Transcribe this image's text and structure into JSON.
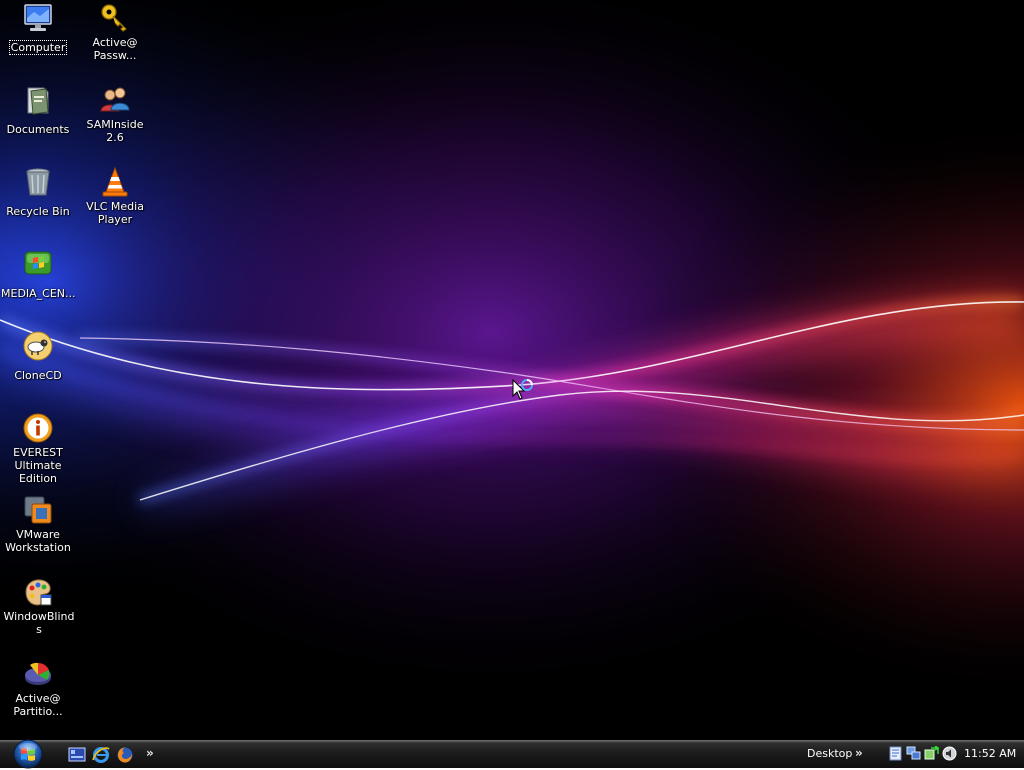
{
  "desktop": {
    "icons": [
      {
        "label": "Computer",
        "icon": "computer-icon"
      },
      {
        "label": "Documents",
        "icon": "documents-folder-icon"
      },
      {
        "label": "Recycle Bin",
        "icon": "recycle-bin-icon"
      },
      {
        "label": "MEDIA_CEN...",
        "icon": "media-center-icon"
      },
      {
        "label": "CloneCD",
        "icon": "clonecd-sheep-icon"
      },
      {
        "label": "EVEREST Ultimate Edition",
        "icon": "everest-info-icon"
      },
      {
        "label": "VMware Workstation",
        "icon": "vmware-icon"
      },
      {
        "label": "WindowBlinds",
        "icon": "windowblinds-palette-icon"
      },
      {
        "label": "Active@ Partitio...",
        "icon": "partition-pie-icon"
      },
      {
        "label": "Active@ Passw...",
        "icon": "key-icon"
      },
      {
        "label": "SAMInside 2.6",
        "icon": "users-icon"
      },
      {
        "label": "VLC Media Player",
        "icon": "vlc-cone-icon"
      }
    ],
    "selected_icon": "Computer"
  },
  "taskbar": {
    "start_icon": "windows-orb-icon",
    "quick_launch": [
      {
        "icon": "show-desktop-icon"
      },
      {
        "icon": "internet-explorer-icon"
      },
      {
        "icon": "firefox-icon"
      }
    ],
    "quick_launch_more": "»",
    "desktop_toolbar_label": "Desktop",
    "desktop_toolbar_more": "»",
    "tray_icons": [
      "document-tray-icon",
      "network-tray-icon",
      "sync-tray-icon",
      "speaker-tray-icon"
    ],
    "clock": "11:52 AM"
  },
  "colors": {
    "taskbar": "#1c1c1c",
    "wave_blue": "#3a5bff",
    "wave_purple": "#8a2be2",
    "wave_pink": "#ff3aa0",
    "wave_orange": "#ff6a1a"
  }
}
